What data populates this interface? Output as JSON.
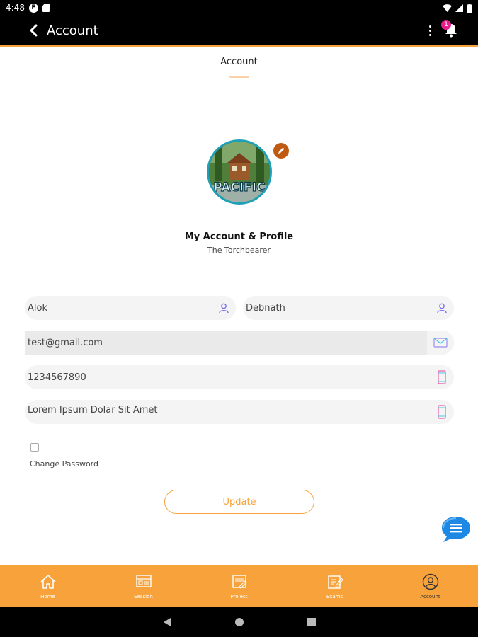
{
  "status_bar": {
    "time": "4:48",
    "app_badge": "F"
  },
  "app_bar": {
    "title": "Account",
    "notification_count": "1"
  },
  "tab": {
    "label": "Account"
  },
  "profile": {
    "title": "My Account & Profile",
    "subtitle": "The Torchbearer",
    "avatar_text": "PACIFIC"
  },
  "form": {
    "first_name": "Alok",
    "last_name": "Debnath",
    "email": "test@gmail.com",
    "phone": "1234567890",
    "address": "Lorem Ipsum Dolar Sit Amet",
    "change_password_label": "Change Password",
    "change_password_checked": false,
    "update_label": "Update"
  },
  "bottom_nav": {
    "items": [
      {
        "label": "Home",
        "icon": "home-icon"
      },
      {
        "label": "Session",
        "icon": "session-icon"
      },
      {
        "label": "Project",
        "icon": "project-icon"
      },
      {
        "label": "Exams",
        "icon": "exams-icon"
      },
      {
        "label": "Account",
        "icon": "account-icon"
      }
    ]
  },
  "colors": {
    "accent": "#f7a23a",
    "avatar_ring": "#1ea0b8",
    "badge": "#e91e8c",
    "chat": "#1e88e5"
  }
}
